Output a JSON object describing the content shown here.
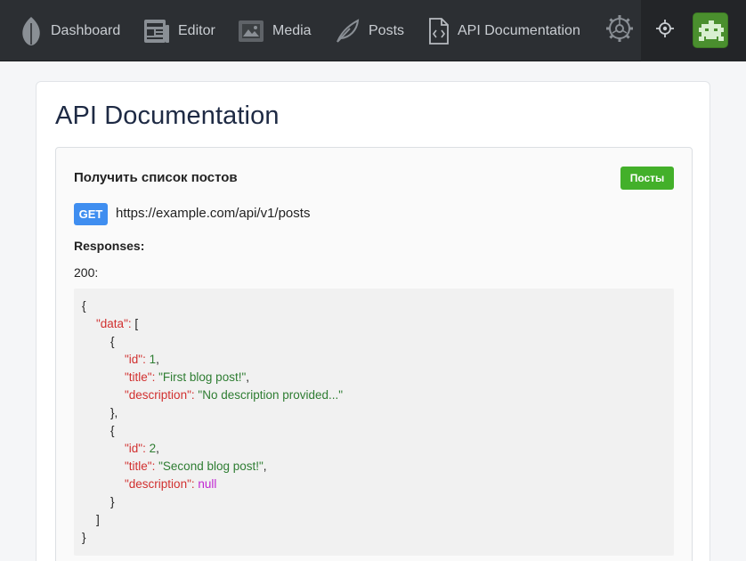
{
  "nav": {
    "items": [
      {
        "label": "Dashboard",
        "icon": "leaf-badge-icon"
      },
      {
        "label": "Editor",
        "icon": "newspaper-icon"
      },
      {
        "label": "Media",
        "icon": "film-image-icon"
      },
      {
        "label": "Posts",
        "icon": "feather-icon"
      },
      {
        "label": "API Documentation",
        "icon": "code-file-icon"
      }
    ],
    "settings_icon": "gear-icon",
    "target_icon": "crosshair-icon",
    "avatar_icon": "pixel-invader-avatar"
  },
  "page": {
    "title": "API Documentation"
  },
  "endpoint": {
    "title": "Получить список постов",
    "button_label": "Посты",
    "method": "GET",
    "url": "https://example.com/api/v1/posts",
    "responses_label": "Responses:",
    "status": "200:"
  },
  "response_json": {
    "data_key": "\"data\"",
    "id_key": "\"id\"",
    "title_key": "\"title\"",
    "description_key": "\"description\"",
    "item1": {
      "id": "1",
      "title": "\"First blog post!\"",
      "description": "\"No description provided...\""
    },
    "item2": {
      "id": "2",
      "title": "\"Second blog post!\"",
      "description": "null"
    }
  },
  "colors": {
    "nav_bg": "#2c2f33",
    "button_green": "#43b02a",
    "method_blue": "#3f8ef0",
    "json_key": "#d1302f",
    "json_string": "#2e7d32",
    "json_null": "#c026d3"
  }
}
